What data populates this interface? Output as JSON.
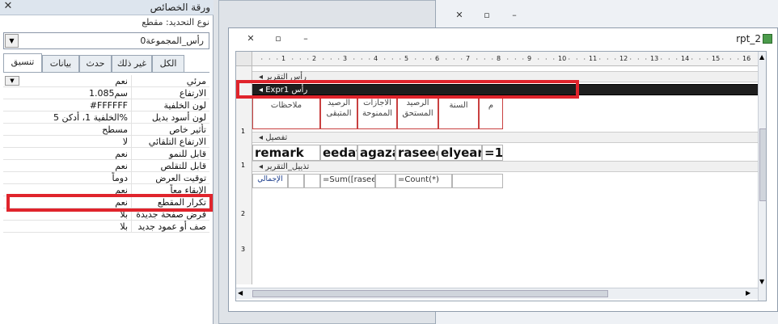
{
  "property_sheet": {
    "title": "ورقة الخصائص",
    "close_glyph": "✕",
    "selection_type_label": "نوع التحديد:",
    "selection_type": "مقطع",
    "selected_object": "رأس_المجموعة0",
    "tabs": [
      "الكل",
      "غير ذلك",
      "حدث",
      "بيانات",
      "تنسيق"
    ],
    "active_tab": "تنسيق",
    "properties": [
      {
        "name": "مرئي",
        "value": "نعم"
      },
      {
        "name": "الارتفاع",
        "value": "1.085سم"
      },
      {
        "name": "لون الخلفية",
        "value": "#FFFFFF"
      },
      {
        "name": "لون أسود بديل",
        "value": "الخلفية 1، أدكن 5%"
      },
      {
        "name": "تأثير خاص",
        "value": "مسطح"
      },
      {
        "name": "الارتفاع التلقائي",
        "value": "لا"
      },
      {
        "name": "قابل للنمو",
        "value": "نعم"
      },
      {
        "name": "قابل للتقلص",
        "value": "نعم"
      },
      {
        "name": "توقيت العرض",
        "value": "دوماً"
      },
      {
        "name": "الإبقاء معاً",
        "value": "نعم"
      },
      {
        "name": "تكرار المقطع",
        "value": "نعم"
      },
      {
        "name": "فرض صفحة جديدة",
        "value": "بلا"
      },
      {
        "name": "صف أو عمود جديد",
        "value": "بلا"
      }
    ]
  },
  "report": {
    "window_title": "rpt_2",
    "ruler_numbers": [
      "1",
      "2",
      "3",
      "4",
      "5",
      "6",
      "7",
      "8",
      "9",
      "10",
      "11",
      "12",
      "13",
      "14",
      "15",
      "16"
    ],
    "vruler_numbers": [
      "1",
      "1",
      "2",
      "3"
    ],
    "sections": {
      "report_header": "رأس التقرير",
      "group_header": "Expr1 رأس",
      "detail": "تفصيل",
      "report_footer": "تذييل_التقرير"
    },
    "column_headers": [
      "م",
      "السنة",
      "الرصيد المستحق",
      "الاجازات الممنوحة",
      "الرصيد المتبقى",
      "ملاحظات"
    ],
    "detail_fields": [
      "=1",
      "elyear",
      "raseed m",
      "agaza",
      "eedat",
      "remark"
    ],
    "footer_fields": [
      "الإجمالي",
      "=Sum([rasee",
      "=Count(*)"
    ]
  },
  "colors": {
    "highlight": "#e0242c",
    "group_header_bar": "#1e1e1e"
  }
}
